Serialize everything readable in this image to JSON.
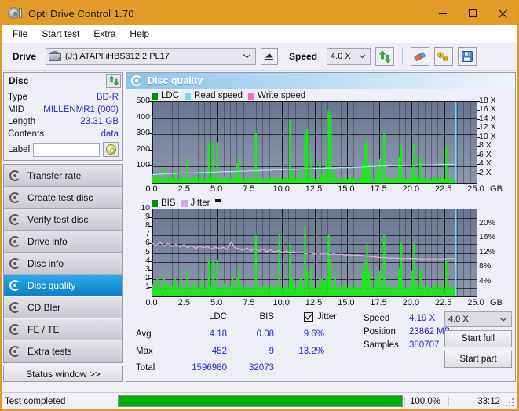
{
  "window": {
    "title": "Opti Drive Control 1.70",
    "icon": "disc-icon",
    "minimize": "minimize-icon",
    "maximize": "maximize-icon",
    "close": "close-icon",
    "accent": "#e49b27"
  },
  "menu": {
    "items": [
      {
        "label": "File"
      },
      {
        "label": "Start test"
      },
      {
        "label": "Extra"
      },
      {
        "label": "Help"
      }
    ]
  },
  "toolbar": {
    "drive_label": "Drive",
    "drive_value": "(J:)  ATAPI iHBS312  2 PL17",
    "eject_icon": "eject-icon",
    "speed_label": "Speed",
    "speed_value": "4.0 X",
    "refresh_icon": "refresh-icon",
    "eraser_icon": "eraser-icon",
    "key_icon": "key-icon",
    "save_icon": "save-icon"
  },
  "disc": {
    "title": "Disc",
    "refresh_icon": "refresh-icon",
    "rows": [
      {
        "key": "Type",
        "value": "BD-R"
      },
      {
        "key": "MID",
        "value": "MILLENMR1 (000)"
      },
      {
        "key": "Length",
        "value": "23.31 GB"
      },
      {
        "key": "Contents",
        "value": "data"
      }
    ],
    "label_key": "Label",
    "label_value": "",
    "label_placeholder": "",
    "label_button_icon": "cd-icon"
  },
  "nav": {
    "items": [
      {
        "label": "Transfer rate",
        "active": false
      },
      {
        "label": "Create test disc",
        "active": false
      },
      {
        "label": "Verify test disc",
        "active": false
      },
      {
        "label": "Drive info",
        "active": false
      },
      {
        "label": "Disc info",
        "active": false
      },
      {
        "label": "Disc quality",
        "active": true
      },
      {
        "label": "CD Bler",
        "active": false
      },
      {
        "label": "FE / TE",
        "active": false
      },
      {
        "label": "Extra tests",
        "active": false
      }
    ],
    "status_window": "Status window >>"
  },
  "panel": {
    "title": "Disc quality",
    "icon": "disc-quality-icon"
  },
  "stats": {
    "columns": [
      "LDC",
      "BIS"
    ],
    "rows": [
      {
        "label": "Avg",
        "ldc": "4.18",
        "bis": "0.08",
        "jitter": "9.6%"
      },
      {
        "label": "Max",
        "ldc": "452",
        "bis": "9",
        "jitter": "13.2%"
      },
      {
        "label": "Total",
        "ldc": "1596980",
        "bis": "32073",
        "jitter": ""
      }
    ],
    "jitter_label": "Jitter",
    "jitter_checked": true,
    "speed_label": "Speed",
    "speed_value": "4.19 X",
    "position_label": "Position",
    "position_value": "23862 MB",
    "samples_label": "Samples",
    "samples_value": "380707",
    "speed_select": "4.0 X",
    "start_full": "Start full",
    "start_part": "Start part"
  },
  "statusbar": {
    "text": "Test completed",
    "percent_label": "100.0%",
    "percent_value": 100,
    "time": "33:12",
    "bar_color": "#00b000"
  },
  "chart_data": [
    {
      "type": "bar",
      "id": "ldc-chart",
      "title": "Disc quality",
      "xlabel": "GB",
      "ylabel": "LDC",
      "xlim": [
        0,
        25
      ],
      "ylim": [
        0,
        500
      ],
      "y2lim": [
        0,
        18
      ],
      "y2label": "X",
      "grid": true,
      "legend_position": "top-left",
      "legend": [
        {
          "name": "LDC",
          "color": "#0a8c0a"
        },
        {
          "name": "Read speed",
          "color": "#7fd4f0"
        },
        {
          "name": "Write speed",
          "color": "#f06ad0"
        }
      ],
      "xticks": [
        "0.0",
        "2.5",
        "5.0",
        "7.5",
        "10.0",
        "12.5",
        "15.0",
        "17.5",
        "20.0",
        "22.5",
        "25.0"
      ],
      "yticks": [
        100,
        200,
        300,
        400,
        500
      ],
      "y2ticks": [
        "2 X",
        "4 X",
        "6 X",
        "8 X",
        "10 X",
        "12 X",
        "14 X",
        "16 X",
        "18 X"
      ],
      "data_end_gb": 23.4,
      "ldc_values": [
        40,
        25,
        60,
        30,
        20,
        95,
        25,
        35,
        22,
        28,
        70,
        20,
        25,
        60,
        24,
        30,
        150,
        28,
        20,
        45,
        26,
        22,
        30,
        80,
        25,
        20,
        255,
        30,
        245,
        28,
        250,
        25,
        22,
        36,
        30,
        25,
        28,
        60,
        24,
        120,
        155,
        30,
        26,
        22,
        28,
        35,
        20,
        25,
        305,
        26,
        24,
        30,
        20,
        28,
        25,
        35,
        22,
        30,
        26,
        40,
        24,
        22,
        30,
        25,
        388,
        70,
        22,
        30,
        28,
        70,
        25,
        310,
        330,
        26,
        180,
        30,
        24,
        22,
        120,
        55,
        40,
        135,
        450,
        420,
        30,
        75,
        25,
        22,
        30,
        28,
        35,
        22,
        28,
        40,
        26,
        22,
        24,
        30,
        120,
        235,
        275,
        120,
        26,
        24,
        60,
        95,
        145,
        20,
        300,
        28,
        25,
        30,
        24,
        22,
        28,
        160,
        230,
        26,
        24,
        30,
        22,
        95,
        240,
        35,
        26,
        160,
        22,
        30,
        28,
        24,
        20,
        26,
        40,
        22,
        28,
        30,
        25,
        230,
        28,
        22,
        30,
        24
      ],
      "read_speed_series": [
        1.8,
        1.9,
        2.0,
        2.1,
        2.1,
        2.2,
        2.2,
        2.2,
        2.3,
        2.3,
        2.4,
        2.4,
        2.5,
        2.5,
        2.5,
        2.6,
        2.6,
        2.7,
        2.7,
        2.8,
        2.8,
        2.9,
        2.9,
        3.0,
        3.0,
        3.0,
        3.1,
        3.1,
        3.2,
        3.2,
        3.3,
        3.3,
        3.4,
        3.4,
        3.4,
        3.5,
        3.5,
        3.6,
        3.6,
        3.7,
        3.7,
        3.8,
        3.8,
        3.8,
        3.9,
        3.9,
        4.0,
        4.0,
        4.0,
        4.1,
        4.1,
        4.1,
        4.1
      ]
    },
    {
      "type": "bar",
      "id": "bis-chart",
      "xlabel": "GB",
      "ylabel": "BIS",
      "xlim": [
        0,
        25
      ],
      "ylim": [
        0,
        10
      ],
      "y2lim": [
        0,
        20
      ],
      "y2label": "%",
      "grid": true,
      "legend_position": "top-left",
      "legend": [
        {
          "name": "BIS",
          "color": "#0a8c0a"
        },
        {
          "name": "Jitter",
          "color": "#d8a8dc"
        }
      ],
      "xticks": [
        "0.0",
        "2.5",
        "5.0",
        "7.5",
        "10.0",
        "12.5",
        "15.0",
        "17.5",
        "20.0",
        "22.5",
        "25.0"
      ],
      "yticks": [
        1,
        2,
        3,
        4,
        5,
        6,
        7,
        8,
        9,
        10
      ],
      "y2ticks": [
        "4%",
        "8%",
        "12%",
        "16%",
        "20%"
      ],
      "data_end_gb": 23.4,
      "bis_values": [
        1.4,
        1.0,
        2.1,
        1.2,
        1.0,
        2.2,
        1.1,
        1.5,
        1.0,
        1.2,
        2.2,
        1.0,
        1.1,
        2.1,
        1.0,
        1.2,
        3.1,
        1.1,
        1.0,
        1.8,
        1.1,
        1.0,
        1.2,
        2.2,
        1.0,
        1.0,
        4.2,
        1.2,
        4.1,
        1.1,
        4.2,
        1.0,
        1.0,
        1.5,
        1.2,
        1.0,
        1.1,
        2.1,
        1.0,
        2.2,
        3.1,
        1.2,
        1.1,
        1.0,
        1.1,
        1.4,
        1.0,
        1.0,
        7.0,
        1.1,
        1.0,
        1.2,
        1.0,
        1.1,
        1.0,
        1.4,
        1.0,
        1.2,
        1.1,
        7.2,
        1.0,
        1.0,
        1.2,
        1.0,
        6.0,
        2.1,
        1.0,
        1.2,
        1.1,
        2.2,
        1.0,
        8.1,
        3.0,
        1.1,
        3.2,
        1.2,
        1.0,
        1.0,
        2.2,
        2.0,
        1.6,
        2.4,
        7.1,
        4.0,
        1.2,
        2.2,
        1.0,
        1.0,
        1.2,
        1.1,
        1.5,
        1.0,
        1.1,
        1.6,
        1.0,
        1.0,
        1.2,
        1.0,
        3.0,
        4.0,
        6.0,
        3.0,
        1.1,
        1.0,
        2.1,
        2.2,
        3.0,
        1.0,
        7.1,
        1.2,
        1.0,
        1.2,
        1.0,
        1.0,
        1.1,
        3.2,
        6.1,
        1.1,
        1.0,
        1.2,
        1.0,
        3.0,
        6.1,
        1.5,
        1.1,
        3.2,
        1.0,
        1.2,
        1.1,
        1.0,
        1.0,
        1.1,
        1.6,
        1.0,
        1.1,
        1.2,
        1.0,
        4.2,
        1.1,
        1.0,
        1.2,
        1.0
      ],
      "jitter_series": [
        12.2,
        11.8,
        12.4,
        11.6,
        12.2,
        11.5,
        12.0,
        11.4,
        11.9,
        11.2,
        11.8,
        11.0,
        11.6,
        11.2,
        11.5,
        10.9,
        11.4,
        11.0,
        11.3,
        10.8,
        12.5,
        11.2,
        11.0,
        10.6,
        11.2,
        10.5,
        11.0,
        10.4,
        10.9,
        10.3,
        10.7,
        10.2,
        10.5,
        10.1,
        10.4,
        10.0,
        10.3,
        9.9,
        10.2,
        9.8,
        10.1,
        9.7,
        10.0,
        9.7,
        9.9,
        9.6,
        9.8,
        9.6,
        9.7,
        9.5,
        9.6,
        9.4,
        9.5,
        9.4,
        9.3,
        9.2,
        9.1,
        9.0,
        8.9,
        8.9,
        8.8,
        8.8,
        8.8,
        8.7,
        8.7,
        8.7,
        8.7,
        8.7,
        8.6,
        8.6,
        8.6,
        8.6,
        8.6,
        8.6,
        8.6,
        8.7,
        8.7,
        8.7
      ]
    }
  ]
}
